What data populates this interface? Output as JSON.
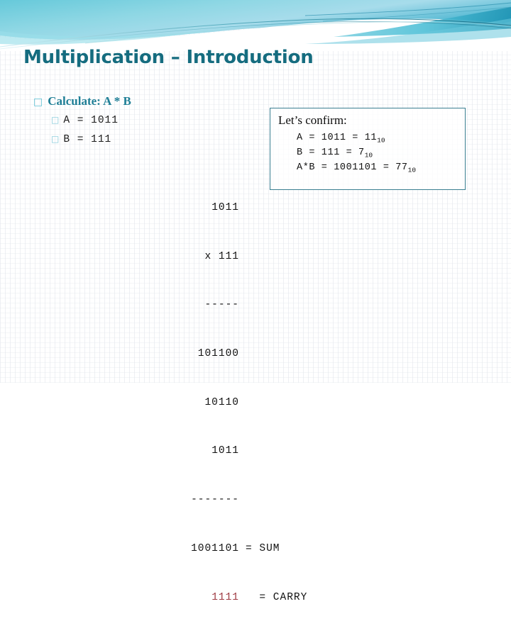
{
  "slide": {
    "title": "Multiplication – Introduction",
    "title_color": "#156c7f",
    "accent_color": "#3a7f91",
    "carry_color": "#9e3a42",
    "background_color": "#ffffff"
  },
  "banner": {
    "name": "decorative-wave-banner",
    "colors": [
      "#8fd5e3",
      "#58c6db",
      "#2aa7c4",
      "#1f7f96",
      "#ffffff"
    ]
  },
  "bullets": {
    "marker_glyph": "□",
    "level1": {
      "text": "Calculate: A * B"
    },
    "level2": [
      {
        "text": "A = 1011"
      },
      {
        "text": "B = 111"
      }
    ]
  },
  "confirm_box": {
    "title": "Let’s confirm:",
    "lines": [
      {
        "lhs": "A   = 1011    = 11",
        "sub": "10"
      },
      {
        "lhs": "B   = 111     = 7",
        "sub": "10"
      },
      {
        "lhs": "A*B = 1001101 = 77",
        "sub": "10"
      }
    ]
  },
  "worksheet": {
    "rows": [
      {
        "num": "1011",
        "tag": ""
      },
      {
        "num": "x 111",
        "tag": ""
      },
      {
        "num": "-----",
        "tag": ""
      },
      {
        "num": "101100",
        "tag": ""
      },
      {
        "num": "10110",
        "tag": ""
      },
      {
        "num": "1011",
        "tag": ""
      },
      {
        "num": "-------",
        "tag": ""
      },
      {
        "num": "1001101",
        "tag": "= SUM"
      },
      {
        "num": "1111",
        "tag": "  = CARRY",
        "highlight": true
      }
    ]
  }
}
